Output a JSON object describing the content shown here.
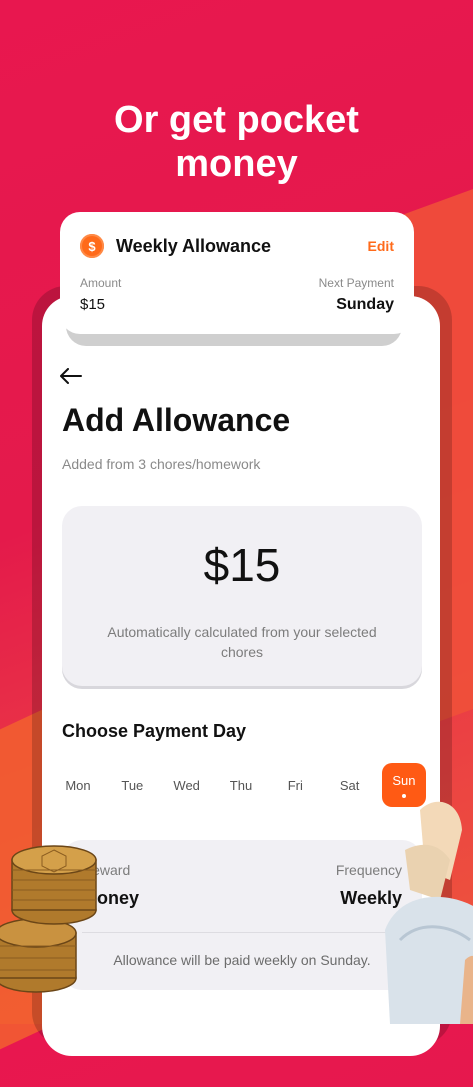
{
  "headline": {
    "line1": "Or get pocket",
    "line2": "money"
  },
  "float_card": {
    "icon": "dollar-coin-icon",
    "title": "Weekly Allowance",
    "edit_label": "Edit",
    "amount_label": "Amount",
    "amount_value": "$15",
    "next_payment_label": "Next Payment",
    "next_payment_value": "Sunday"
  },
  "screen": {
    "back_icon": "back-arrow-icon",
    "title": "Add Allowance",
    "subtitle": "Added from 3 chores/homework",
    "amount_card": {
      "value": "$15",
      "note": "Automatically calculated from your selected chores"
    },
    "payment_day": {
      "title": "Choose Payment Day",
      "days": [
        "Mon",
        "Tue",
        "Wed",
        "Thu",
        "Fri",
        "Sat",
        "Sun"
      ],
      "selected": "Sun"
    },
    "summary": {
      "reward_label": "Reward",
      "reward_value": "Money",
      "frequency_label": "Frequency",
      "frequency_value": "Weekly",
      "note": "Allowance will be paid weekly on Sunday."
    }
  },
  "colors": {
    "background": "#e8174f",
    "accent": "#ff5a14",
    "card": "#f1f0f4"
  }
}
